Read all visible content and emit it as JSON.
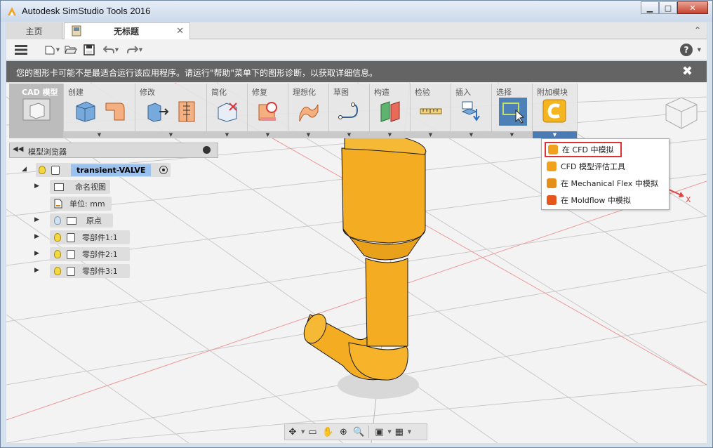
{
  "window": {
    "title": "Autodesk SimStudio Tools 2016",
    "minimize": "▁",
    "maximize": "□",
    "close": "✕"
  },
  "tabs": {
    "home": "主页",
    "document": "无标题",
    "close": "✕",
    "collapse": "⌃"
  },
  "toolbar": {
    "menu_icon": "menu-icon",
    "new_icon": "new-file-icon",
    "open_icon": "open-folder-icon",
    "save_icon": "save-icon",
    "undo_icon": "undo-icon",
    "redo_icon": "redo-icon",
    "help_label": "?"
  },
  "warning": {
    "text": "您的图形卡可能不是最适合运行该应用程序。请运行\"帮助\"菜单下的图形诊断，以获取详细信息。",
    "close": "✖"
  },
  "ribbon": {
    "groups": [
      {
        "label": "CAD 模型",
        "icon": "cad-model-icon"
      },
      {
        "label": "创建",
        "icon": "create-box-icon"
      },
      {
        "label": "修改",
        "icon": "modify-icon"
      },
      {
        "label": "简化",
        "icon": "simplify-icon"
      },
      {
        "label": "修复",
        "icon": "repair-icon"
      },
      {
        "label": "理想化",
        "icon": "idealize-icon"
      },
      {
        "label": "草图",
        "icon": "sketch-icon"
      },
      {
        "label": "构造",
        "icon": "construct-icon"
      },
      {
        "label": "检验",
        "icon": "inspect-icon"
      },
      {
        "label": "插入",
        "icon": "insert-icon"
      },
      {
        "label": "选择",
        "icon": "select-icon"
      },
      {
        "label": "附加模块",
        "icon": "addins-icon"
      }
    ]
  },
  "browser": {
    "title": "模型浏览器",
    "root": "transient-VALVE",
    "items": [
      {
        "label": "命名视图"
      },
      {
        "label": "单位: mm"
      },
      {
        "label": "原点"
      },
      {
        "label": "零部件1:1"
      },
      {
        "label": "零部件2:1"
      },
      {
        "label": "零部件3:1"
      }
    ]
  },
  "addins_menu": {
    "items": [
      {
        "label": "在 CFD 中模拟",
        "color": "#f0a21f"
      },
      {
        "label": "CFD 模型评估工具",
        "color": "#f0a21f"
      },
      {
        "label": "在 Mechanical Flex 中模拟",
        "color": "#e58f1a"
      },
      {
        "label": "在 Moldflow 中模拟",
        "color": "#e6551c"
      }
    ]
  },
  "axis": {
    "x_label": "X"
  },
  "colors": {
    "part": "#f4ad22",
    "part_shadow": "#c9831a",
    "accent": "#4b7bb4",
    "warning_bg": "#646464"
  }
}
